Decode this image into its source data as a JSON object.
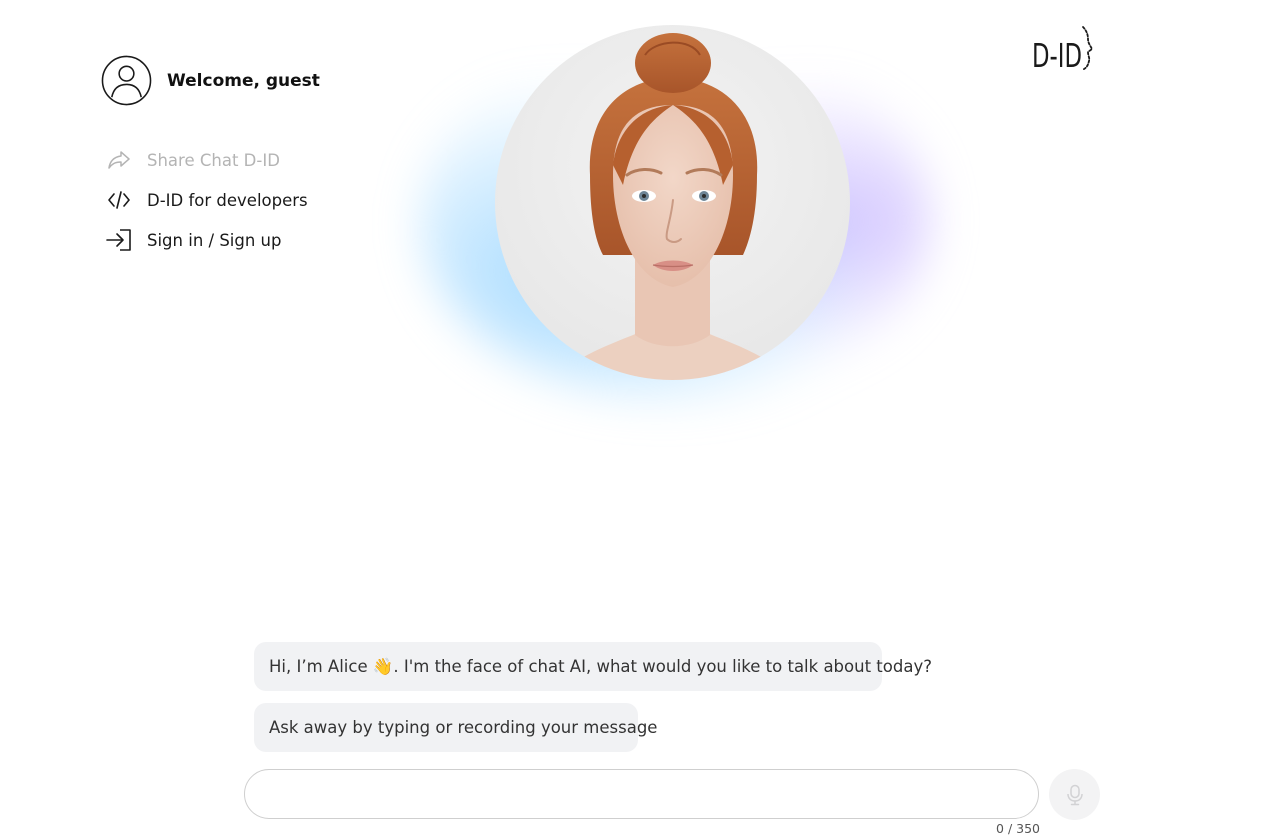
{
  "user": {
    "welcome_text": "Welcome, guest",
    "avatar_icon": "user-circle-icon"
  },
  "menu": {
    "items": [
      {
        "label": "Share Chat D-ID",
        "icon": "share-arrow-icon",
        "disabled": true
      },
      {
        "label": "D-ID for developers",
        "icon": "code-icon",
        "disabled": false
      },
      {
        "label": "Sign in / Sign up",
        "icon": "sign-in-icon",
        "disabled": false
      }
    ]
  },
  "brand": {
    "logo_text": "D-ID",
    "glow_blue": "#96d4ff",
    "glow_purple": "#cdbeff"
  },
  "chat": {
    "messages": [
      {
        "text": "Hi, I’m Alice 👋. I'm the face of chat AI, what would you like to talk about today?"
      },
      {
        "text": "Ask away by typing or recording your message"
      }
    ]
  },
  "composer": {
    "value": "",
    "placeholder": "",
    "counter": "0 / 350",
    "mic_icon": "microphone-icon"
  }
}
